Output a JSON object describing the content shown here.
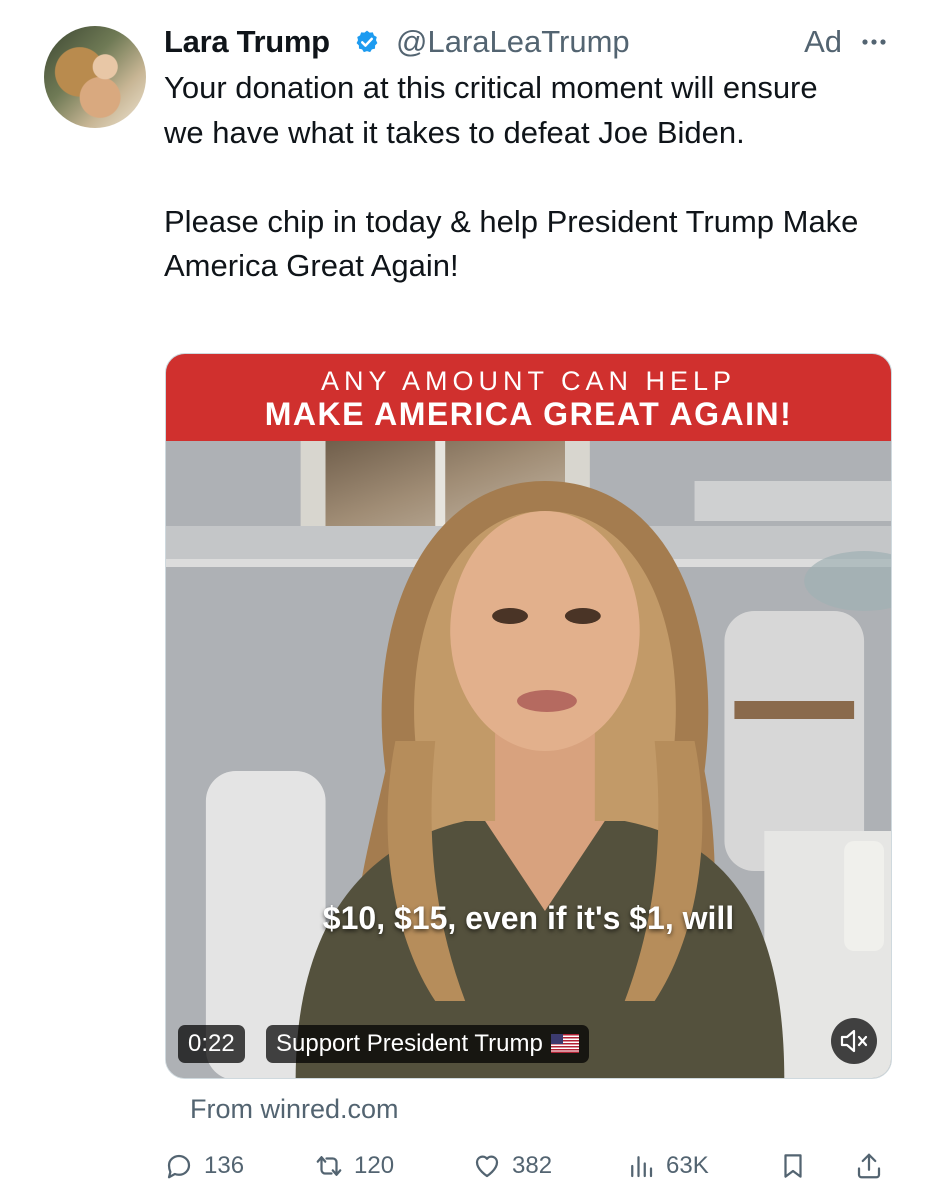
{
  "tweet": {
    "author_name": "Lara Trump",
    "handle": "@LaraLeaTrump",
    "ad_label": "Ad",
    "paragraphs": [
      "Your donation at this critical moment will ensure we have what it takes to defeat Joe Biden.",
      "Please chip in today & help President Trump Make America Great Again!"
    ]
  },
  "media": {
    "banner_top": "ANY AMOUNT CAN HELP",
    "banner_main": "MAKE AMERICA GREAT AGAIN!",
    "caption": "$10, $15, even if it's $1, will",
    "duration": "0:22",
    "source_label": "Support President Trump"
  },
  "from_label": "From winred.com",
  "actions": {
    "replies": "136",
    "reposts": "120",
    "likes": "382",
    "views": "63K"
  },
  "icons": {
    "verified": "verified-badge-icon",
    "more": "more-icon",
    "mute": "mute-icon",
    "flag": "us-flag-icon",
    "reply": "reply-icon",
    "repost": "repost-icon",
    "like": "like-icon",
    "views": "views-icon",
    "bookmark": "bookmark-icon",
    "share": "share-icon"
  },
  "colors": {
    "verified": "#1d9bf0",
    "banner": "#d0302e",
    "secondary_text": "#536471"
  }
}
